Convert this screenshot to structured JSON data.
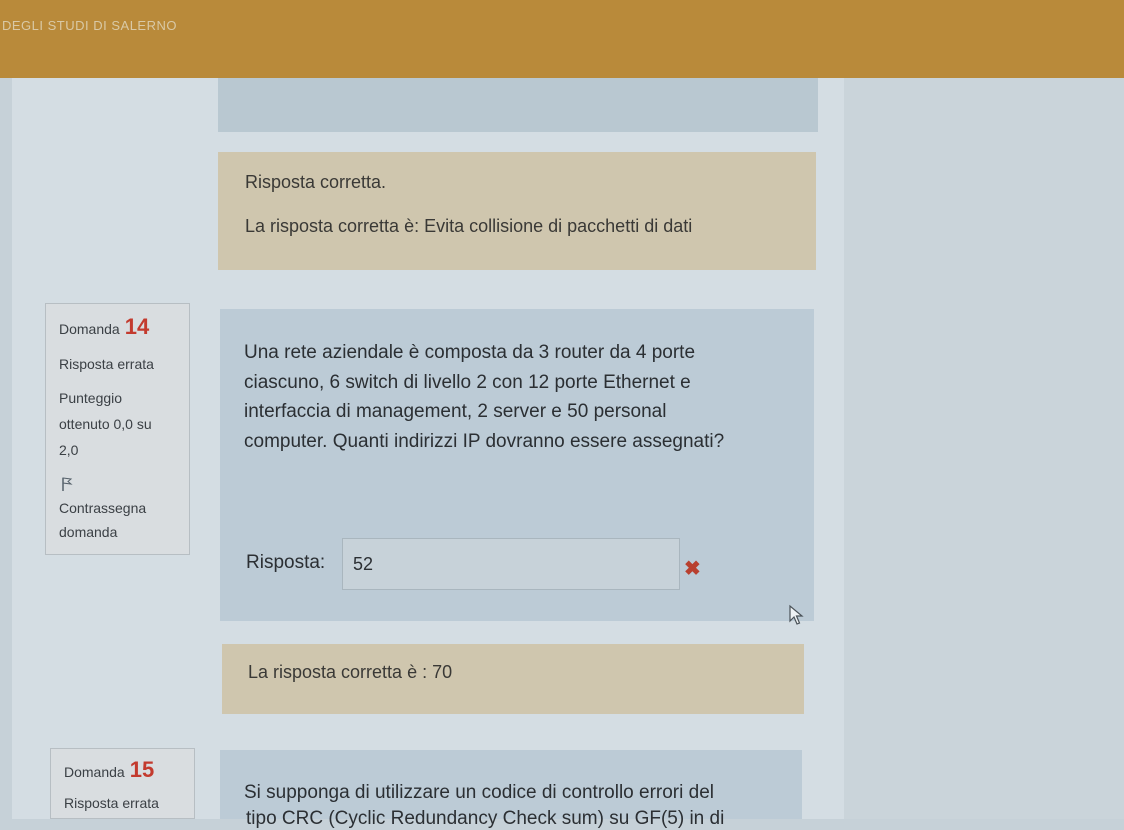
{
  "header": {
    "brand_text": "DEGLI STUDI DI SALERNO"
  },
  "feedback_q13": {
    "result": "Risposta corretta.",
    "correct_answer": "La risposta corretta è: Evita collisione di pacchetti di dati"
  },
  "question14": {
    "label": "Domanda",
    "number": "14",
    "status": "Risposta errata",
    "score_line1": "Punteggio",
    "score_line2": "ottenuto 0,0 su",
    "score_line3": "2,0",
    "flag_line1": "Contrassegna",
    "flag_line2": "domanda",
    "text_lines": [
      "Una rete aziendale è composta da 3 router da 4 porte",
      "ciascuno, 6 switch di livello 2 con 12 porte Ethernet e",
      "interfaccia di management, 2 server e 50 personal",
      "computer. Quanti indirizzi IP dovranno essere assegnati?"
    ],
    "answer_label": "Risposta:",
    "answer_value": "52",
    "wrong_mark": "✖",
    "feedback": "La risposta corretta è : 70"
  },
  "question15": {
    "label": "Domanda",
    "number": "15",
    "status": "Risposta errata",
    "text_line1": "Si supponga di utilizzare un codice di controllo errori del",
    "text_line2_partial": "tipo CRC (Cyclic Redundancy Check sum) su GF(5) in di"
  },
  "icons": {
    "flag": "flag-icon",
    "wrong": "wrong-answer-icon",
    "cursor": "mouse-cursor-icon"
  },
  "colors": {
    "header": "#b98a3a",
    "question_number": "#c33a2e",
    "wrong_mark": "#b8402f",
    "feedback_bg": "#cfc6ae",
    "question_bg": "#bccbd6"
  }
}
